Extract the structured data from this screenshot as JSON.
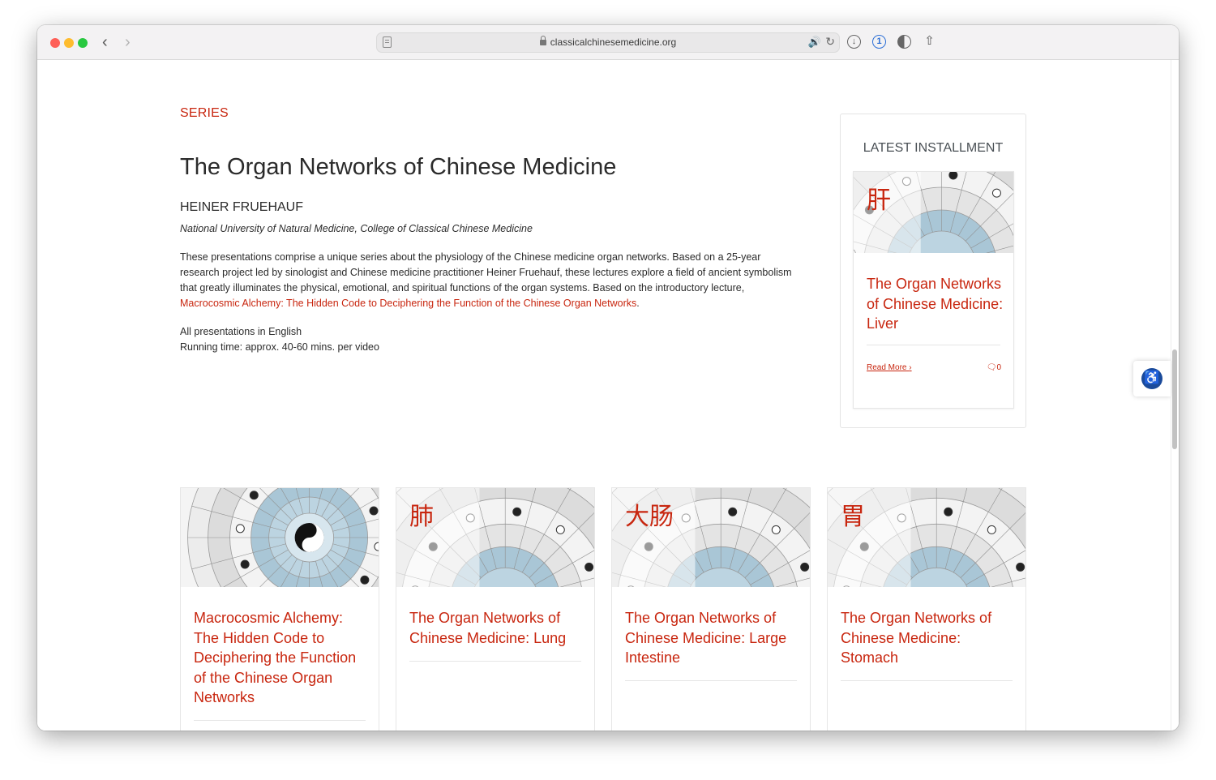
{
  "browser": {
    "url": "classicalchinesemedicine.org"
  },
  "page": {
    "eyebrow": "SERIES",
    "title": "The Organ Networks of Chinese Medicine",
    "author": "HEINER FRUEHAUF",
    "affiliation": "National University of Natural Medicine, College of Classical Chinese Medicine",
    "description_before": "These presentations comprise a unique series about the physiology of the Chinese medicine organ networks. Based on a 25-year research project led by sinologist and Chinese medicine practitioner Heiner Fruehauf, these lectures explore a field of ancient symbolism that greatly illuminates the physical, emotional, and spiritual functions of the organ systems. Based on the introductory lecture, ",
    "description_link": "Macrocosmic Alchemy: The Hidden Code to Deciphering the Function of the Chinese Organ Networks",
    "description_after": ".",
    "language": "All presentations in English",
    "running_time": "Running time: approx. 40-60 mins. per video"
  },
  "sidebar": {
    "heading": "LATEST INSTALLMENT",
    "card": {
      "glyph": "肝",
      "title": "The Organ Networks of Chinese Medicine: Liver",
      "read_more": "Read More",
      "comment_count": "0"
    }
  },
  "cards": [
    {
      "glyph": "",
      "title": "Macrocosmic Alchemy: The Hidden Code to Deciphering the Function of the Chinese Organ Networks"
    },
    {
      "glyph": "肺",
      "title": "The Organ Networks of Chinese Medicine: Lung"
    },
    {
      "glyph": "大肠",
      "title": "The Organ Networks of Chinese Medicine: Large Intestine"
    },
    {
      "glyph": "胃",
      "title": "The Organ Networks of Chinese Medicine: Stomach"
    }
  ],
  "colors": {
    "accent": "#c8260f",
    "text": "#2b2b2b",
    "wheel_blue": "#a9c6d6"
  }
}
